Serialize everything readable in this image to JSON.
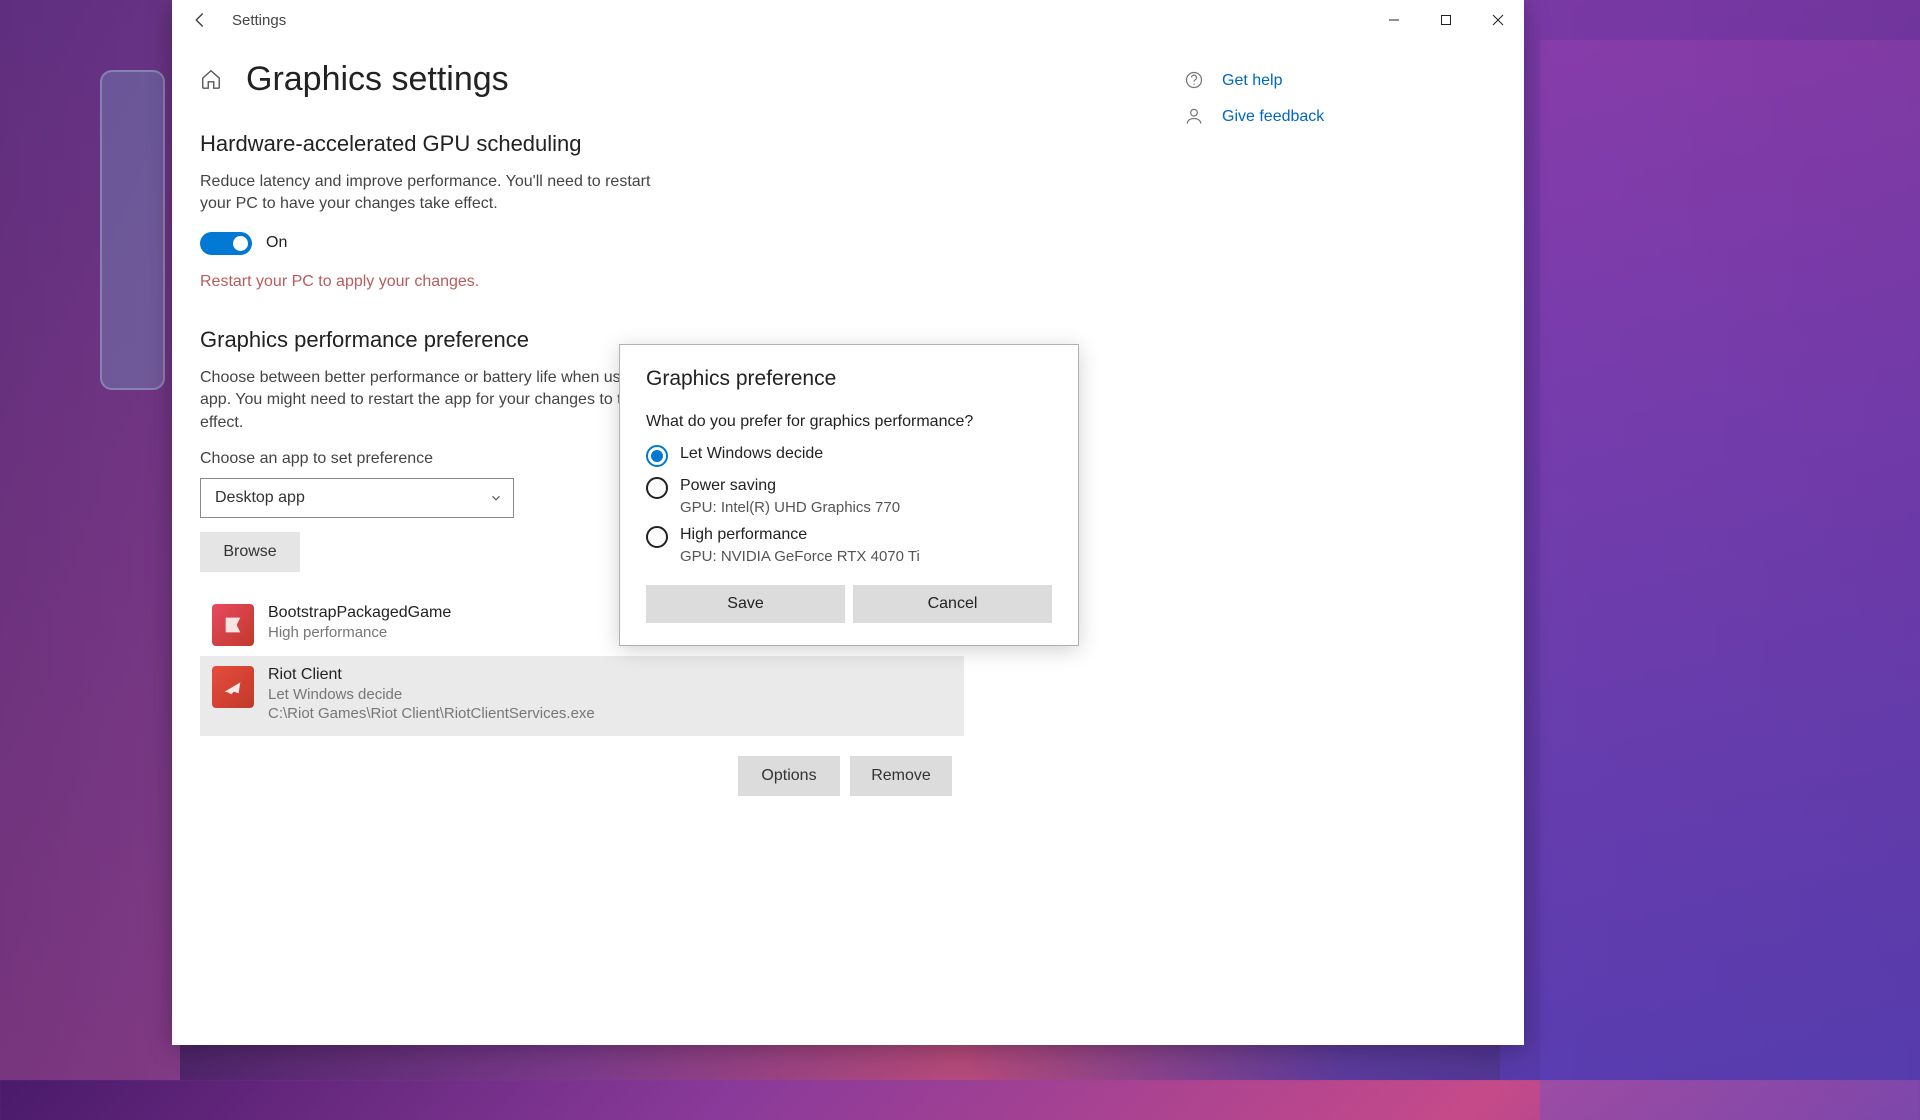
{
  "window": {
    "title": "Settings"
  },
  "page": {
    "title": "Graphics settings"
  },
  "gpu_scheduling": {
    "heading": "Hardware-accelerated GPU scheduling",
    "description": "Reduce latency and improve performance. You'll need to restart your PC to have your changes take effect.",
    "toggle_state": "On",
    "restart_note": "Restart your PC to apply your changes."
  },
  "perf_pref": {
    "heading": "Graphics performance preference",
    "description": "Choose between better performance or battery life when using an app. You might need to restart the app for your changes to take effect.",
    "choose_label": "Choose an app to set preference",
    "dropdown_value": "Desktop app",
    "browse_label": "Browse"
  },
  "apps": [
    {
      "name": "BootstrapPackagedGame",
      "pref": "High performance",
      "path": "",
      "icon_color": "red",
      "selected": false
    },
    {
      "name": "Riot Client",
      "pref": "Let Windows decide",
      "path": "C:\\Riot Games\\Riot Client\\RiotClientServices.exe",
      "icon_color": "riot",
      "selected": true
    }
  ],
  "app_actions": {
    "options": "Options",
    "remove": "Remove"
  },
  "help_links": {
    "get_help": "Get help",
    "give_feedback": "Give feedback"
  },
  "dialog": {
    "title": "Graphics preference",
    "question": "What do you prefer for graphics performance?",
    "options": [
      {
        "label": "Let Windows decide",
        "sub": "",
        "checked": true
      },
      {
        "label": "Power saving",
        "sub": "GPU: Intel(R) UHD Graphics 770",
        "checked": false
      },
      {
        "label": "High performance",
        "sub": "GPU: NVIDIA GeForce RTX 4070 Ti",
        "checked": false
      }
    ],
    "save": "Save",
    "cancel": "Cancel"
  }
}
